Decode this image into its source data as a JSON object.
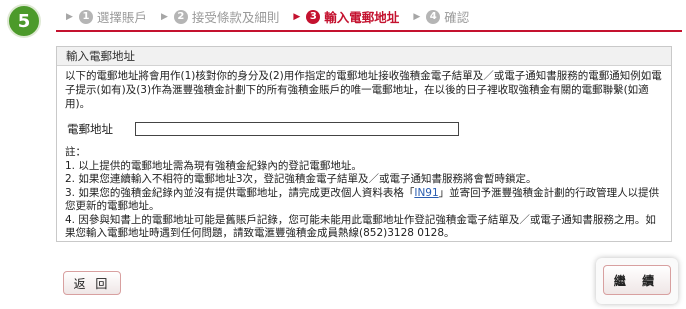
{
  "step_badge": "5",
  "steps": [
    {
      "num": "1",
      "label": "選擇賬戶"
    },
    {
      "num": "2",
      "label": "接受條款及細則"
    },
    {
      "num": "3",
      "label": "輸入電郵地址"
    },
    {
      "num": "4",
      "label": "確認"
    }
  ],
  "active_step": "3",
  "panel": {
    "title": "輸入電郵地址",
    "intro": "以下的電郵地址將會用作(1)核對你的身分及(2)用作指定的電郵地址接收強積金電子結單及／或電子通知書服務的電郵通知例如電子提示(如有)及(3)作為滙豐強積金計劃下的所有強積金賬戶的唯一電郵地址，在以後的日子裡收取強積金有關的電郵聯繫(如適用)。",
    "email_label": "電郵地址",
    "email_value": "",
    "notes_heading": "註：",
    "note1": "1. 以上提供的電郵地址需為現有強積金紀錄內的登記電郵地址。",
    "note2": "2. 如果您連續輸入不相符的電郵地址3次，登記強積金電子結單及／或電子通知書服務將會暫時鎖定。",
    "note3_before": "3. 如果您的強積金紀錄內並沒有提供電郵地址，請完成更改個人資料表格「",
    "note3_link": "IN91",
    "note3_after": "」並寄回予滙豐強積金計劃的行政管理人以提供您更新的電郵地址。",
    "note4": "4. 因參與知書上的電郵地址可能是舊賬戶記錄，您可能未能用此電郵地址作登記強積金電子結單及／或電子通知書服務之用。如果您輸入電郵地址時遇到任何問題，請致電滙豐強積金成員熱線(852)3128 0128。"
  },
  "buttons": {
    "back": "返 回",
    "next": "繼 續"
  },
  "colors": {
    "accent": "#c4122f",
    "badge": "#4c9a2a",
    "inactive": "#9a9a9a"
  }
}
